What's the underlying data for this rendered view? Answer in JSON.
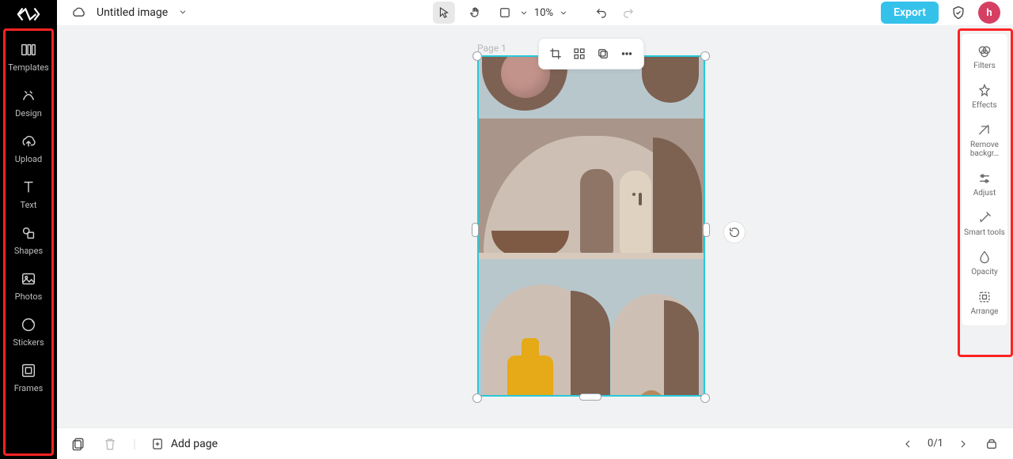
{
  "header": {
    "title": "Untitled image",
    "zoom": "10%",
    "export_label": "Export",
    "avatar_initial": "h"
  },
  "left_sidebar": {
    "items": [
      {
        "label": "Templates",
        "icon": "templates"
      },
      {
        "label": "Design",
        "icon": "design"
      },
      {
        "label": "Upload",
        "icon": "upload"
      },
      {
        "label": "Text",
        "icon": "text"
      },
      {
        "label": "Shapes",
        "icon": "shapes"
      },
      {
        "label": "Photos",
        "icon": "photos"
      },
      {
        "label": "Stickers",
        "icon": "stickers"
      },
      {
        "label": "Frames",
        "icon": "frames"
      }
    ]
  },
  "right_sidebar": {
    "items": [
      {
        "label": "Filters"
      },
      {
        "label": "Effects"
      },
      {
        "label": "Remove backgr…"
      },
      {
        "label": "Adjust"
      },
      {
        "label": "Smart tools"
      },
      {
        "label": "Opacity"
      },
      {
        "label": "Arrange"
      }
    ]
  },
  "canvas": {
    "page_label": "Page 1"
  },
  "bottom": {
    "add_page": "Add page",
    "page_counter": "0/1"
  }
}
